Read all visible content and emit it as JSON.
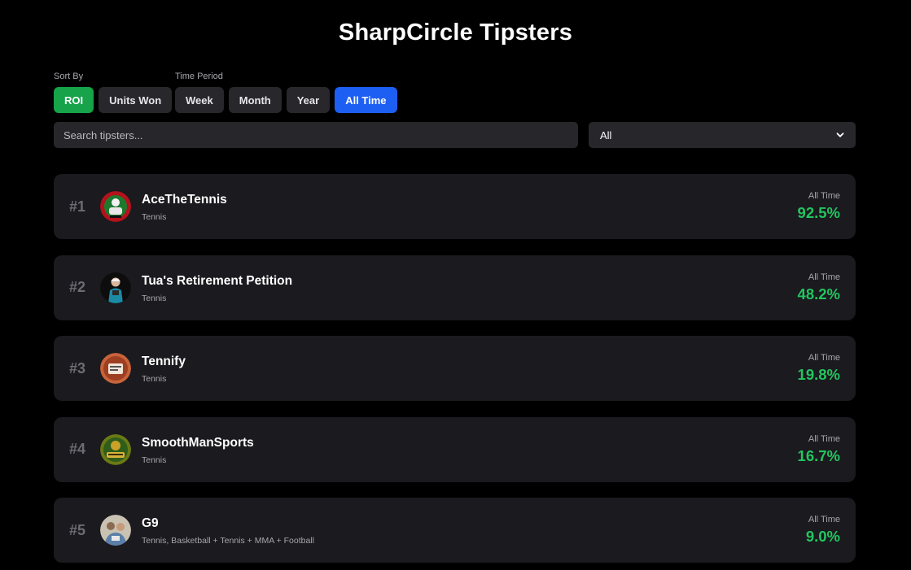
{
  "title": "SharpCircle Tipsters",
  "sort": {
    "label": "Sort By",
    "options": [
      "ROI",
      "Units Won"
    ],
    "active": "ROI"
  },
  "period": {
    "label": "Time Period",
    "options": [
      "Week",
      "Month",
      "Year",
      "All Time"
    ],
    "active": "All Time"
  },
  "search": {
    "placeholder": "Search tipsters...",
    "value": ""
  },
  "filter": {
    "selected": "All"
  },
  "colors": {
    "accent_green": "#16a34a",
    "accent_blue": "#1d5ff2",
    "roi_green": "#22c55e",
    "card_bg": "#1a1a1f"
  },
  "tipsters": [
    {
      "rank": "#1",
      "name": "AceTheTennis",
      "sports": "Tennis",
      "period": "All Time",
      "roi": "92.5%",
      "avatar_icon": "red-tennis-avatar"
    },
    {
      "rank": "#2",
      "name": "Tua's Retirement Petition",
      "sports": "Tennis",
      "period": "All Time",
      "roi": "48.2%",
      "avatar_icon": "player-photo-avatar"
    },
    {
      "rank": "#3",
      "name": "Tennify",
      "sports": "Tennis",
      "period": "All Time",
      "roi": "19.8%",
      "avatar_icon": "orange-logo-avatar"
    },
    {
      "rank": "#4",
      "name": "SmoothManSports",
      "sports": "Tennis",
      "period": "All Time",
      "roi": "16.7%",
      "avatar_icon": "green-gold-logo-avatar"
    },
    {
      "rank": "#5",
      "name": "G9",
      "sports": "Tennis, Basketball + Tennis + MMA + Football",
      "period": "All Time",
      "roi": "9.0%",
      "avatar_icon": "group-photo-avatar"
    }
  ]
}
